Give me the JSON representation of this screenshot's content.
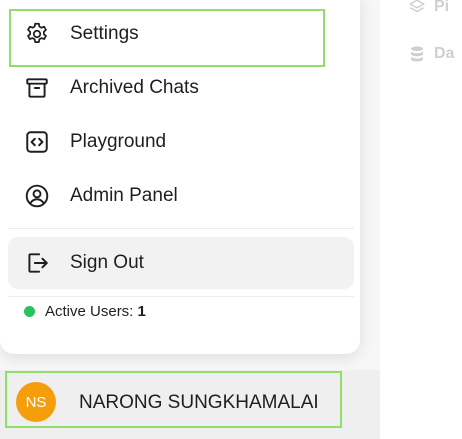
{
  "background": {
    "items": [
      {
        "label": "Pi",
        "icon": "layers-icon"
      },
      {
        "label": "Da",
        "icon": "database-icon"
      }
    ]
  },
  "menu": {
    "settings_label": "Settings",
    "archived_label": "Archived Chats",
    "playground_label": "Playground",
    "admin_label": "Admin Panel",
    "signout_label": "Sign Out",
    "active_users_label": "Active Users:",
    "active_users_count": "1"
  },
  "user": {
    "initials": "NS",
    "name": "NARONG SUNGKHAMALAI"
  },
  "colors": {
    "status_active": "#22c55e",
    "avatar_bg": "#f59e0b",
    "focus_outline": "#8ee06a"
  }
}
